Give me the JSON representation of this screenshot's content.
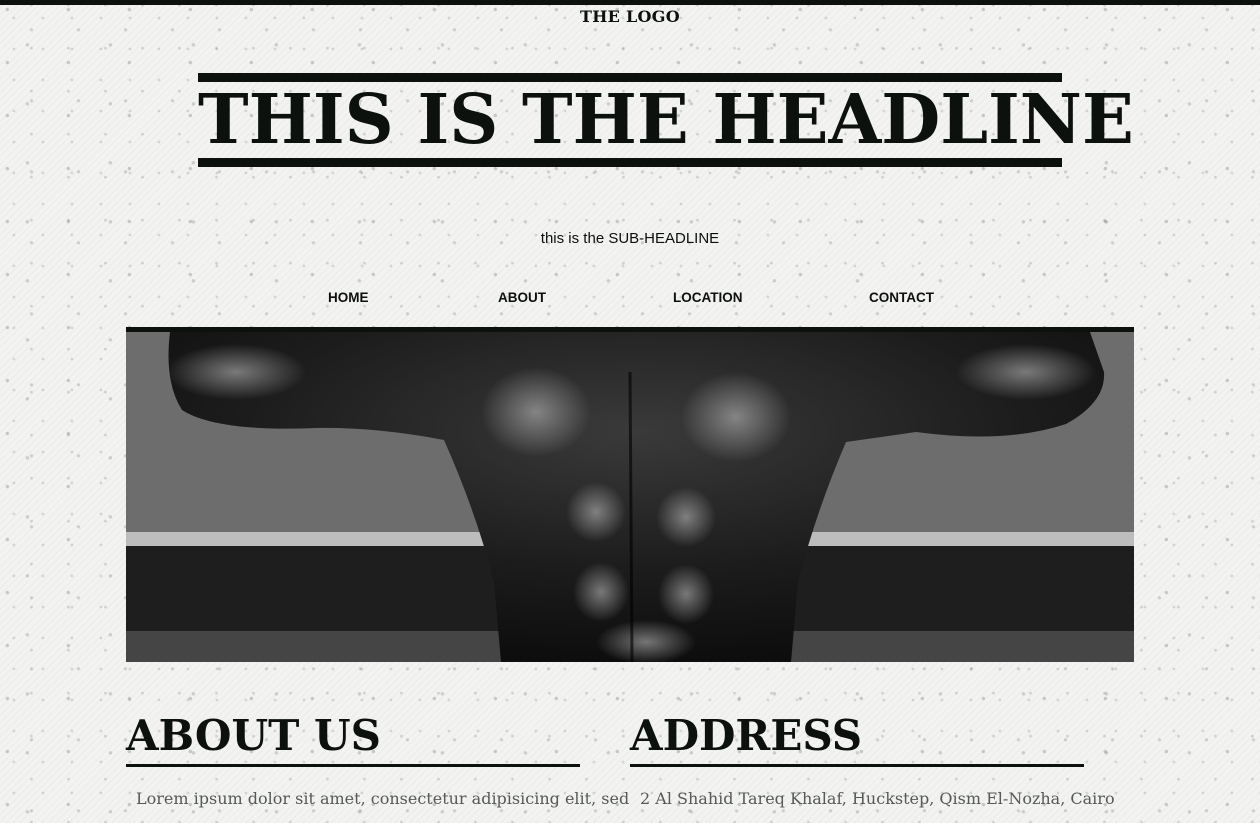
{
  "logo": "THE LOGO",
  "headline": "THIS IS THE HEADLINE",
  "subheadline": "this is the SUB-HEADLINE",
  "nav": [
    "HOME",
    "ABOUT",
    "LOCATION",
    "CONTACT"
  ],
  "hero": {
    "image_alt": "muscular torso, black and white"
  },
  "about": {
    "title": "ABOUT US",
    "text": "Lorem ipsum dolor sit amet, consectetur adipisicing elit, sed"
  },
  "address": {
    "title": "ADDRESS",
    "text": "2 Al Shahid Tareq Khalaf, Huckstep, Qism El-Nozha, Cairo"
  },
  "colors": {
    "ink": "#0c110d",
    "paper": "#f3f3f1",
    "body_text": "#555a56"
  }
}
